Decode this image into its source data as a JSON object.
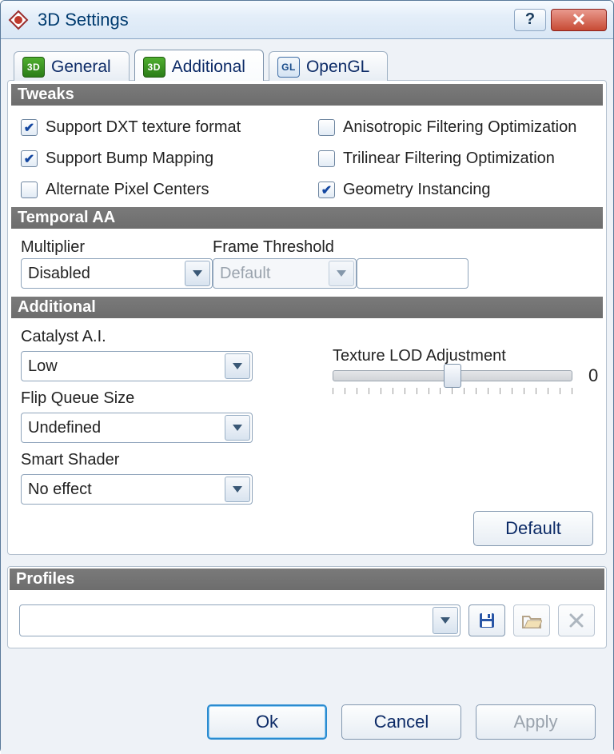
{
  "window": {
    "title": "3D Settings"
  },
  "tabs": {
    "general": {
      "label": "General",
      "badge": "3D"
    },
    "additional": {
      "label": "Additional",
      "badge": "3D"
    },
    "opengl": {
      "label": "OpenGL",
      "badge": "GL"
    }
  },
  "sections": {
    "tweaks": "Tweaks",
    "temporal": "Temporal AA",
    "additional": "Additional",
    "profiles": "Profiles"
  },
  "tweaks": {
    "dxt": {
      "label": "Support DXT texture format",
      "checked": true
    },
    "aniso": {
      "label": "Anisotropic Filtering Optimization",
      "checked": false
    },
    "bump": {
      "label": "Support Bump Mapping",
      "checked": true
    },
    "trilinear": {
      "label": "Trilinear Filtering Optimization",
      "checked": false
    },
    "pixelcenters": {
      "label": "Alternate Pixel Centers",
      "checked": false
    },
    "geometry": {
      "label": "Geometry Instancing",
      "checked": true
    }
  },
  "temporalAA": {
    "multiplier_label": "Multiplier",
    "multiplier_value": "Disabled",
    "framethreshold_label": "Frame Threshold",
    "framethreshold_value": "Default",
    "fps_value": ""
  },
  "additional": {
    "catalyst_label": "Catalyst A.I.",
    "catalyst_value": "Low",
    "flipqueue_label": "Flip Queue Size",
    "flipqueue_value": "Undefined",
    "smartshader_label": "Smart Shader",
    "smartshader_value": "No effect",
    "lod_label": "Texture LOD Adjustment",
    "lod_value": "0"
  },
  "buttons": {
    "default": "Default",
    "ok": "Ok",
    "cancel": "Cancel",
    "apply": "Apply"
  },
  "profiles": {
    "selected": ""
  }
}
